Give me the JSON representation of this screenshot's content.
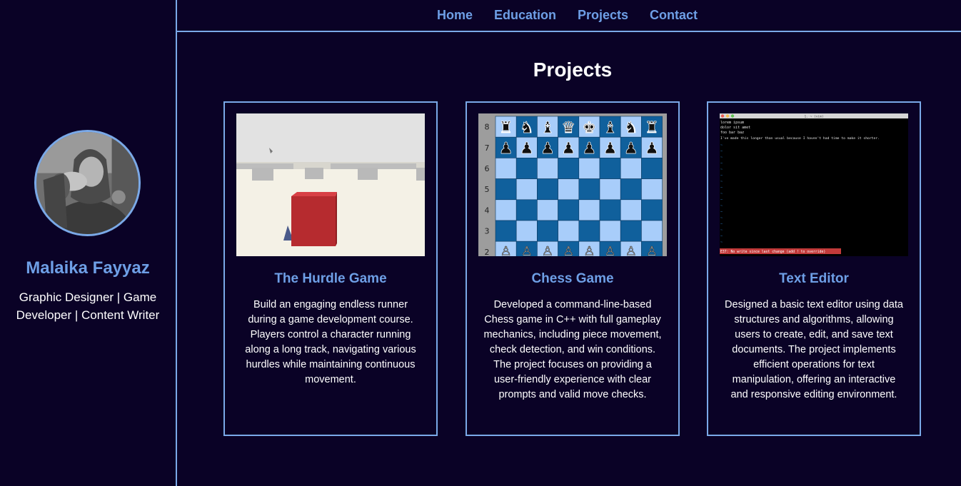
{
  "profile": {
    "name": "Malaika Fayyaz",
    "tagline": "Graphic Designer | Game Developer | Content Writer"
  },
  "nav": {
    "items": [
      {
        "label": "Home"
      },
      {
        "label": "Education"
      },
      {
        "label": "Projects"
      },
      {
        "label": "Contact"
      }
    ]
  },
  "section": {
    "title": "Projects"
  },
  "projects": [
    {
      "title": "The Hurdle Game",
      "thumbnail": "hurdle-game-screenshot",
      "description": "Build an engaging endless runner during a game development course. Players control a character running along a long track, navigating various hurdles while maintaining continuous movement."
    },
    {
      "title": "Chess Game",
      "thumbnail": "chess-board-screenshot",
      "ranks": [
        "8",
        "7",
        "6",
        "5",
        "4",
        "3",
        "2"
      ],
      "description": "Developed a command-line-based Chess game in C++ with full gameplay mechanics, including piece movement, check detection, and win conditions. The project focuses on providing a user-friendly experience with clear prompts and valid move checks."
    },
    {
      "title": "Text Editor",
      "thumbnail": "text-editor-screenshot",
      "editor": {
        "window_title": "1. ~ (vim)",
        "lines": [
          "lorem ipsum",
          "dolor sit amet",
          "foo bar baz",
          "I've made this longer than usual because I haven't had time to make it shorter."
        ],
        "status": "E37: No write since last change (add ! to override)"
      },
      "description": "Designed a basic text editor using data structures and algorithms, allowing users to create, edit, and save text documents. The project implements efficient operations for text manipulation, offering an interactive and responsive editing environment."
    }
  ],
  "colors": {
    "background": "#0a0226",
    "accent": "#6e9fe6",
    "border": "#7aa9e8"
  }
}
